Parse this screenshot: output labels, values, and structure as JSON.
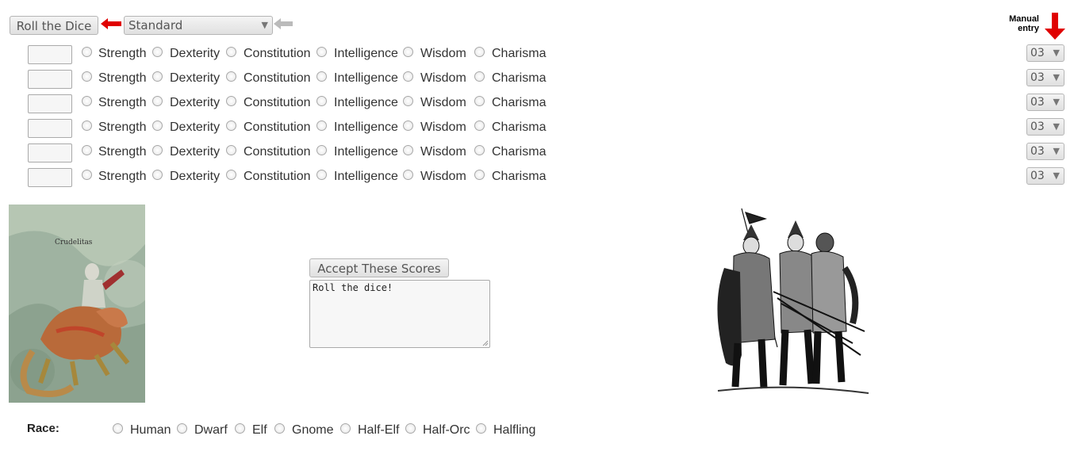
{
  "toolbar": {
    "roll_label": "Roll the Dice",
    "method_selected": "Standard",
    "manual_entry_label_line1": "Manual",
    "manual_entry_label_line2": "entry"
  },
  "abilities": [
    "Strength",
    "Dexterity",
    "Constitution",
    "Intelligence",
    "Wisdom",
    "Charisma"
  ],
  "score_rows": [
    {
      "value": "",
      "manual": "03"
    },
    {
      "value": "",
      "manual": "03"
    },
    {
      "value": "",
      "manual": "03"
    },
    {
      "value": "",
      "manual": "03"
    },
    {
      "value": "",
      "manual": "03"
    },
    {
      "value": "",
      "manual": "03"
    }
  ],
  "accept_label": "Accept These Scores",
  "result_text": "Roll the dice!",
  "race": {
    "label": "Race:",
    "options": [
      "Human",
      "Dwarf",
      "Elf",
      "Gnome",
      "Half-Elf",
      "Half-Orc",
      "Halfling"
    ]
  },
  "colors": {
    "arrow_red": "#e00000",
    "arrow_gray": "#bbbbbb"
  }
}
